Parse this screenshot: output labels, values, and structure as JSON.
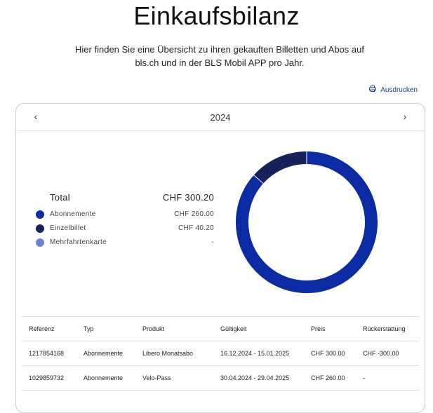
{
  "page": {
    "title": "Einkaufsbilanz",
    "intro": "Hier finden Sie eine Übersicht zu ihren gekauften Billetten und Abos auf bls.ch und in der BLS Mobil APP pro Jahr.",
    "print_label": "Ausdrucken"
  },
  "year_selector": {
    "year": "2024",
    "prev_icon": "chevron-left-icon",
    "next_icon": "chevron-right-icon"
  },
  "summary": {
    "total_label": "Total",
    "total_value": "CHF 300.20",
    "items": [
      {
        "label": "Abonnemente",
        "value": "CHF 260.00",
        "color": "#0a2ba3",
        "amount": 260.0
      },
      {
        "label": "Einzelbillet",
        "value": "CHF 40.20",
        "color": "#15235a",
        "amount": 40.2
      },
      {
        "label": "Mehrfahrtenkarte",
        "value": "-",
        "color": "#6f82cf",
        "amount": 0
      }
    ]
  },
  "table": {
    "headers": [
      "Referenz",
      "Typ",
      "Produkt",
      "Gültigkeit",
      "Preis",
      "Rückerstattung"
    ],
    "rows": [
      [
        "1217854168",
        "Abonnemente",
        "Libero Monatsabo",
        "16.12.2024 - 15.01.2025",
        "CHF 300.00",
        "CHF -300.00"
      ],
      [
        "1029859732",
        "Abonnemente",
        "Velo-Pass",
        "30.04.2024 - 29.04.2025",
        "CHF 260.00",
        "-"
      ]
    ]
  }
}
